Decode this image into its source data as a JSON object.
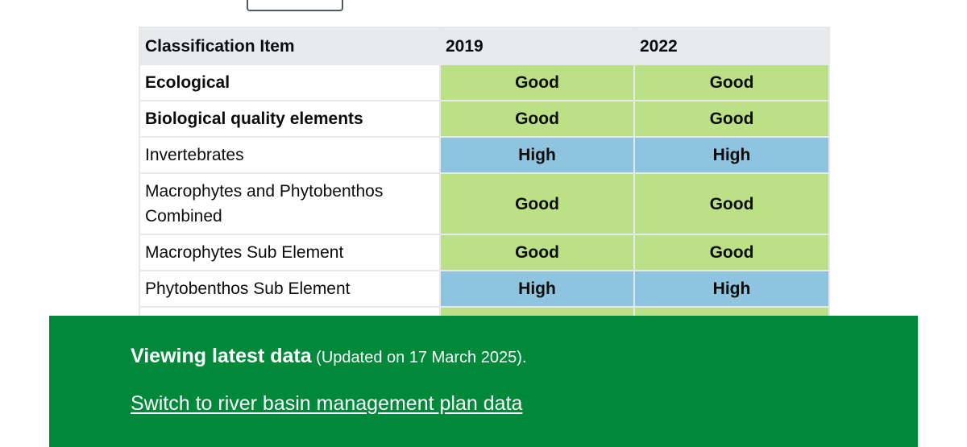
{
  "table": {
    "headers": [
      "Classification Item",
      "2019",
      "2022"
    ],
    "rows": [
      {
        "label": "Ecological",
        "y2019": "Good",
        "y2022": "Good"
      },
      {
        "label": "Biological quality elements",
        "y2019": "Good",
        "y2022": "Good"
      },
      {
        "label": "Invertebrates",
        "y2019": "High",
        "y2022": "High"
      },
      {
        "label": "Macrophytes and Phytobenthos Combined",
        "y2019": "Good",
        "y2022": "Good"
      },
      {
        "label": "Macrophytes Sub Element",
        "y2019": "Good",
        "y2022": "Good"
      },
      {
        "label": "Phytobenthos Sub Element",
        "y2019": "High",
        "y2022": "High"
      },
      {
        "label": "",
        "y2019": "",
        "y2022": ""
      }
    ]
  },
  "status_colors": {
    "good": "#bce085",
    "high": "#8ec4df"
  },
  "banner": {
    "title": "Viewing latest data",
    "updated": "(Updated on 17 March 2025).",
    "link": "Switch to river basin management plan data",
    "background": "#00893a"
  }
}
